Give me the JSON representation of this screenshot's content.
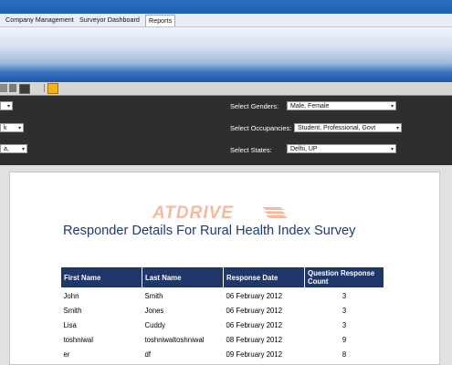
{
  "tabs": [
    "Company Management",
    "Surveyor Dashboard",
    "Reports"
  ],
  "filters": {
    "left_values": [
      "",
      "k",
      "a,"
    ],
    "genders_label": "Select Genders:",
    "genders_value": "Male, Female",
    "occupancies_label": "Select Occupancies:",
    "occupancies_value": "Student, Professional, Govt",
    "states_label": "Select States:",
    "states_value": "Delhi, UP"
  },
  "report": {
    "logo_text": "ATDRIVE",
    "title": "Responder Details For Rural Health Index Survey",
    "headers": [
      "First Name",
      "Last Name",
      "Response Date",
      "Question Response Count"
    ],
    "rows": [
      [
        "John",
        "Smith",
        "06 February 2012",
        "3"
      ],
      [
        "Smith",
        "Jones",
        "06 February 2012",
        "3"
      ],
      [
        "Lisa",
        "Cuddy",
        "06 February 2012",
        "3"
      ],
      [
        "toshniwal",
        "toshniwaltoshniwal",
        "08 February 2012",
        "9"
      ],
      [
        "er",
        "df",
        "09 February 2012",
        "8"
      ]
    ]
  },
  "colors": {
    "header_bg": "#1f3769",
    "title": "#1f3a78",
    "filter_bg": "#2e2e2e"
  }
}
